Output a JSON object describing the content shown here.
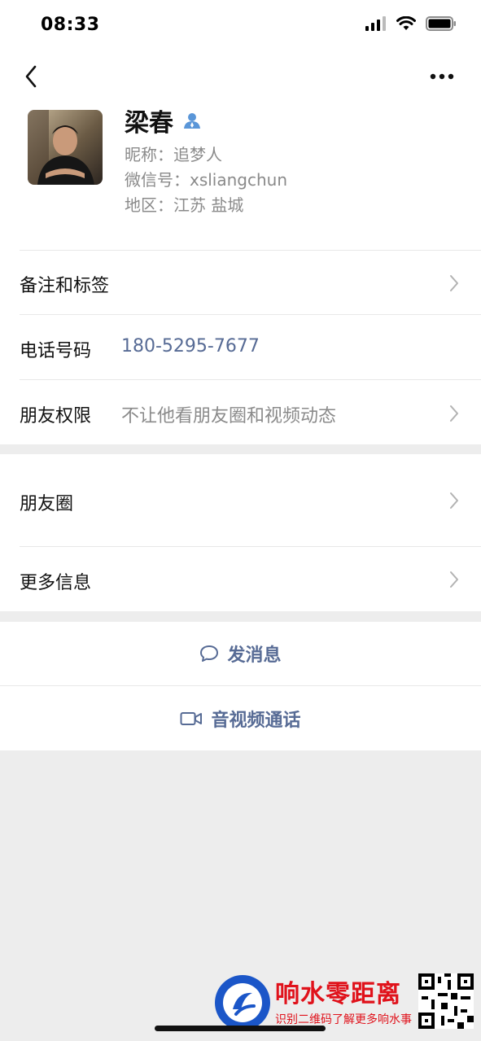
{
  "status_bar": {
    "time": "08:33"
  },
  "profile": {
    "name": "梁春",
    "nickname": "昵称：追梦人",
    "wechat_id": "微信号：xsliangchun",
    "region": "地区：江苏  盐城"
  },
  "rows": {
    "remark_label": "备注和标签",
    "phone_label": "电话号码",
    "phone_value": "180-5295-7677",
    "permission_label": "朋友权限",
    "permission_value": "不让他看朋友圈和视频动态",
    "moments_label": "朋友圈",
    "more_info_label": "更多信息"
  },
  "actions": {
    "message_label": "发消息",
    "call_label": "音视频通话"
  },
  "watermark": {
    "title": "响水零距离",
    "subtitle": "识别二维码了解更多响水事"
  },
  "colors": {
    "link_blue": "#576b95",
    "gray_text": "#8a8a8a",
    "background": "#ededed",
    "watermark_red": "#e0121b"
  },
  "icons": {
    "back": "chevron-left-icon",
    "more": "more-dots-icon",
    "verified": "person-badge-icon",
    "chevron": "chevron-right-icon",
    "message": "chat-bubble-icon",
    "call": "video-camera-icon"
  }
}
